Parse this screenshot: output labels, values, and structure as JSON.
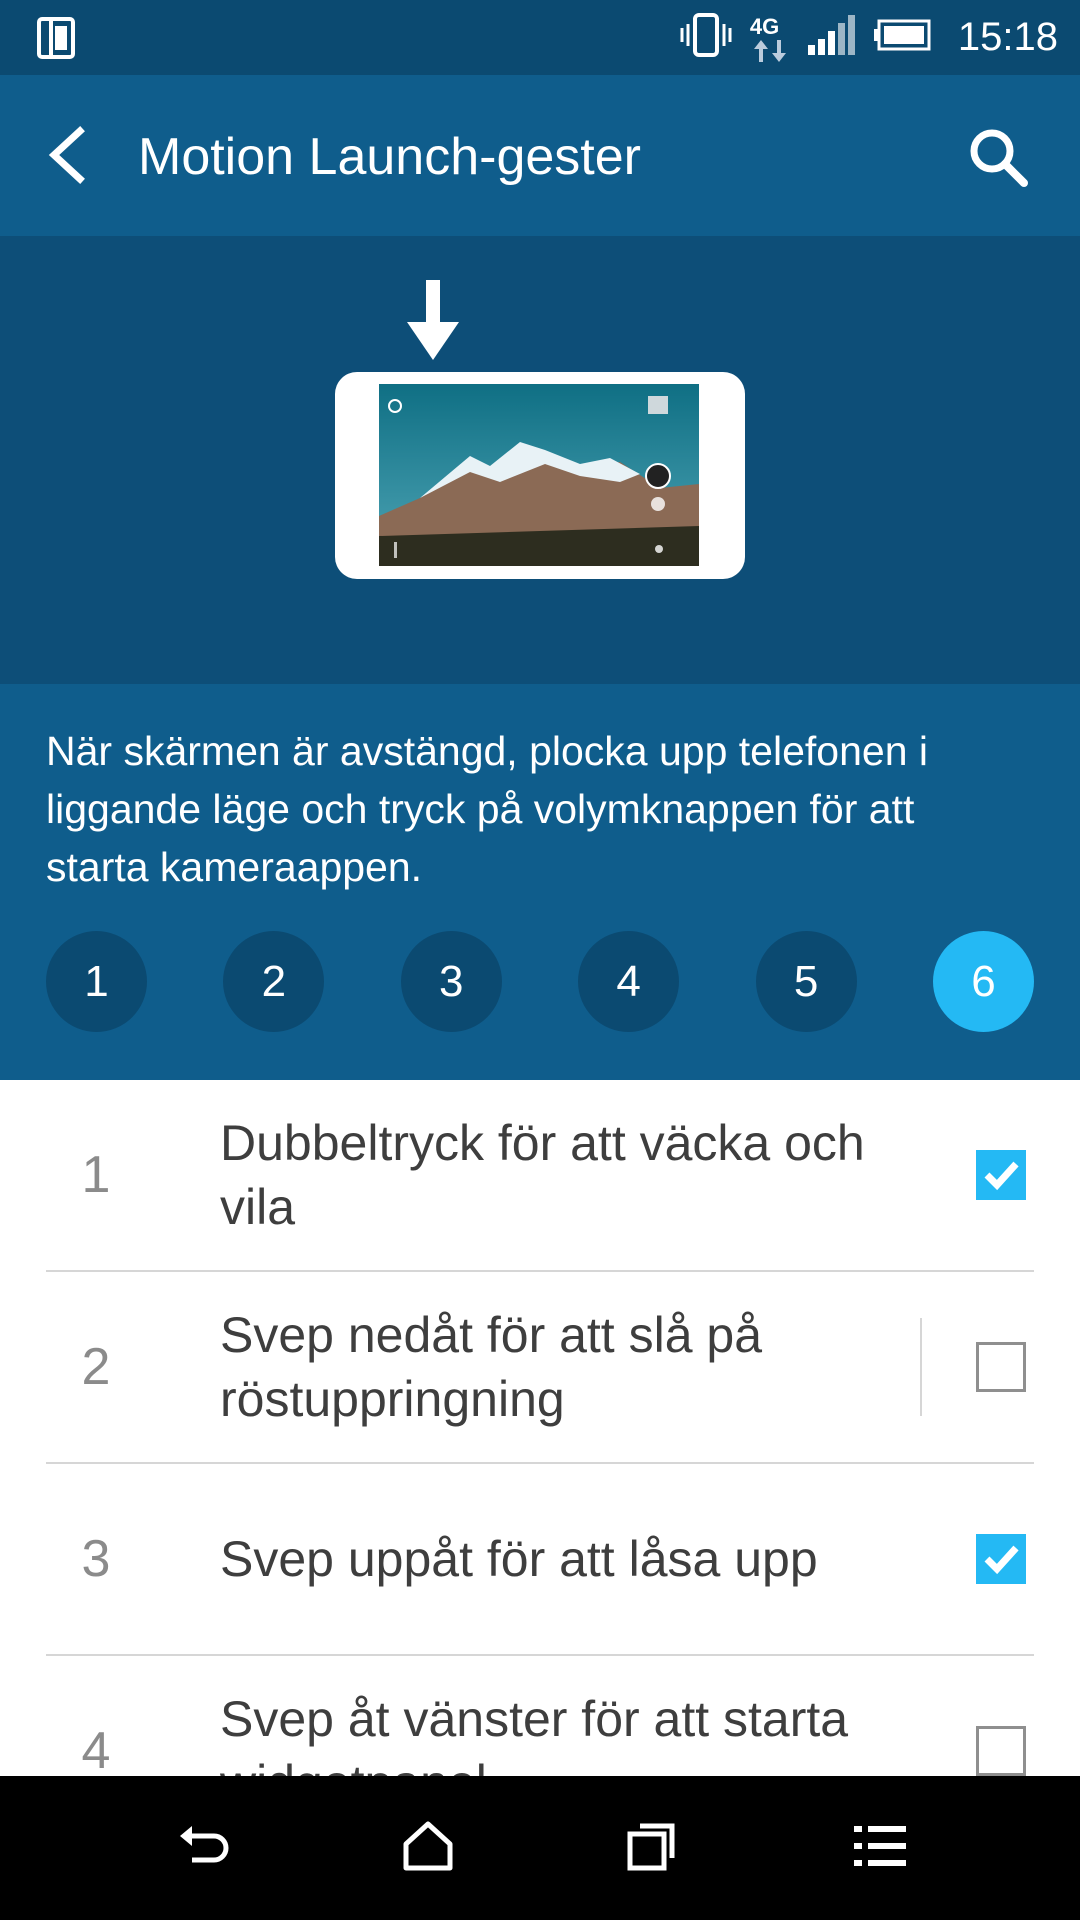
{
  "status_bar": {
    "time": "15:18",
    "network": "4G",
    "icons": [
      "screen-notification-icon",
      "vibrate-icon",
      "4g-data-icon",
      "signal-icon",
      "battery-icon"
    ]
  },
  "app_bar": {
    "title": "Motion Launch-gester",
    "icons": [
      "back-arrow-icon",
      "search-icon"
    ]
  },
  "hero": {
    "illustration": "phone-landscape-camera-illustration"
  },
  "info": {
    "description": "När skärmen är avstängd, plocka upp telefonen i liggande läge och tryck på volymknappen för att starta kameraappen.",
    "steps": [
      "1",
      "2",
      "3",
      "4",
      "5",
      "6"
    ],
    "active_step": "6"
  },
  "gestures": [
    {
      "number": "1",
      "label": "Dubbeltryck för att väcka och vila",
      "checked": true
    },
    {
      "number": "2",
      "label": "Svep nedåt för att slå på röstuppringning",
      "checked": false
    },
    {
      "number": "3",
      "label": "Svep uppåt för att låsa upp",
      "checked": true
    },
    {
      "number": "4",
      "label": "Svep åt vänster för att starta widgetpanel",
      "checked": false
    }
  ],
  "nav_bar": {
    "icons": [
      "back-icon",
      "home-icon",
      "recents-icon",
      "menu-icon"
    ]
  },
  "colors": {
    "status_bar": "#0b4a71",
    "app_bar": "#0f5d8c",
    "accent": "#24b9f4",
    "step_inactive": "#0b4a71"
  }
}
